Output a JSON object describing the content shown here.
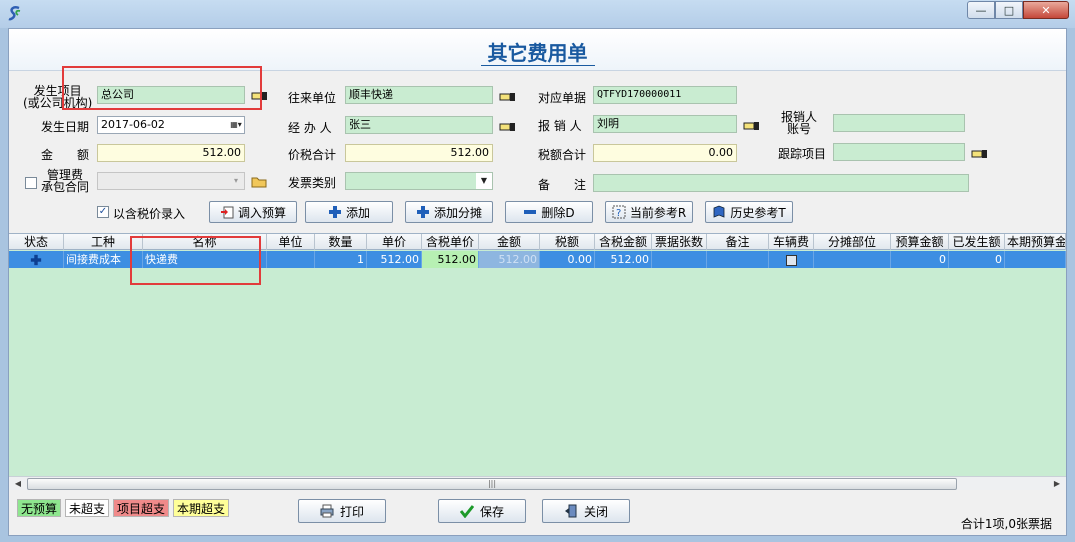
{
  "window": {
    "minimize_glyph": "—",
    "maximize_glyph": "□",
    "close_glyph": "✕"
  },
  "form": {
    "title": "其它费用单",
    "labels": {
      "occurrence_item_l1": "发生项目",
      "occurrence_item_l2": "(或公司机构)",
      "date": "发生日期",
      "amount": "金　　额",
      "mgmt_fee_l1": "管理费",
      "mgmt_fee_l2": "承包合同",
      "counterparty": "往来单位",
      "handler": "经 办 人",
      "total_with_tax": "价税合计",
      "invoice_type": "发票类别",
      "ref_document": "对应单据",
      "reimburser": "报 销 人",
      "tax_total": "税额合计",
      "remarks": "备　　注",
      "reimburse_acct_l1": "报销人",
      "reimburse_acct_l2": "账号",
      "tracking_item": "跟踪项目"
    },
    "values": {
      "occurrence_item": "总公司",
      "date": "2017-06-02",
      "amount": "512.00",
      "mgmt_contract": "",
      "counterparty": "顺丰快递",
      "handler": "张三",
      "total_with_tax": "512.00",
      "invoice_type": "",
      "ref_document": "QTFYD170000011",
      "reimburser": "刘明",
      "tax_total": "0.00",
      "remarks": "",
      "reimburse_account": "",
      "tracking_item": ""
    },
    "checkbox_mgmt_fee": false
  },
  "toolbar": {
    "tax_inclusive_label": "以含税价录入",
    "tax_inclusive_checked": true,
    "buttons": [
      {
        "label": "调入预算",
        "icon": "import-budget-icon"
      },
      {
        "label": "添加",
        "icon": "plus-icon"
      },
      {
        "label": "添加分摊",
        "icon": "plus-icon"
      },
      {
        "label": "删除D",
        "icon": "minus-icon"
      },
      {
        "label": "当前参考R",
        "icon": "help-ref-icon"
      },
      {
        "label": "历史参考T",
        "icon": "book-icon"
      }
    ]
  },
  "grid": {
    "columns": [
      "状态",
      "工种",
      "名称",
      "单位",
      "数量",
      "单价",
      "含税单价",
      "金额",
      "税额",
      "含税金额",
      "票据张数",
      "备注",
      "车辆费",
      "分摊部位",
      "预算金额",
      "已发生额",
      "本期预算金"
    ],
    "rows": [
      {
        "status_icon": "plus-icon",
        "work_type": "间接费成本",
        "name": "快递费",
        "unit": "",
        "qty": "1",
        "unit_price": "512.00",
        "tax_unit_price": "512.00",
        "amount": "512.00",
        "tax": "0.00",
        "tax_amount": "512.00",
        "invoice_count": "",
        "note": "",
        "vehicle_fee": false,
        "alloc_part": "",
        "budget_amount": "0",
        "occurred_amount": "0",
        "period_budget": ""
      }
    ]
  },
  "legend": [
    {
      "label": "无预算",
      "color": "#8ee68e"
    },
    {
      "label": "未超支",
      "color": "#ffffff"
    },
    {
      "label": "项目超支",
      "color": "#f08a8a"
    },
    {
      "label": "本期超支",
      "color": "#ffff99"
    }
  ],
  "bottom_buttons": {
    "print": "打印",
    "save": "保存",
    "close": "关闭"
  },
  "summary": "合计1项,0张票据"
}
